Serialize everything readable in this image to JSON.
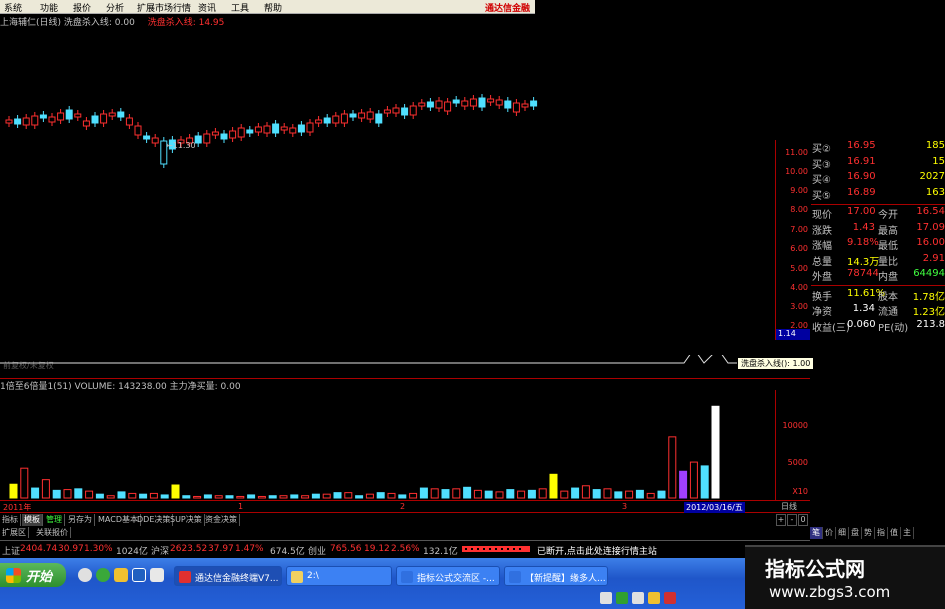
{
  "menu": {
    "items": [
      "系统",
      "功能",
      "报价",
      "分析",
      "扩展市场行情",
      "资讯",
      "工具",
      "帮助"
    ],
    "brand": "通达信金融"
  },
  "chart_title": {
    "main": "上海辅仁(日线)  洗盘杀入线: 0.00",
    "red": "洗盘杀入线: 14.95"
  },
  "kline": {
    "low_label": "←11.30",
    "watermark": "前复权/未复权"
  },
  "yaxis": [
    "11.00",
    "10.00",
    "9.00",
    "8.00",
    "7.00",
    "6.00",
    "5.00",
    "4.00",
    "3.00",
    "2.00"
  ],
  "cursor_value": "1.14",
  "quote": {
    "rows": [
      {
        "l1": "买②",
        "v1": "16.95",
        "l2": "",
        "v2": "185",
        "c1": "#ff3030",
        "c2": "#ffff00"
      },
      {
        "l1": "买③",
        "v1": "16.91",
        "l2": "",
        "v2": "15",
        "c1": "#ff3030",
        "c2": "#ffff00"
      },
      {
        "l1": "买④",
        "v1": "16.90",
        "l2": "",
        "v2": "2027",
        "c1": "#ff3030",
        "c2": "#ffff00"
      },
      {
        "l1": "买⑤",
        "v1": "16.89",
        "l2": "",
        "v2": "163",
        "c1": "#ff3030",
        "c2": "#ffff00"
      },
      {
        "l1": "现价",
        "v1": "17.00",
        "l2": "今开",
        "v2": "16.54",
        "c1": "#ff3030",
        "c2": "#ff3030"
      },
      {
        "l1": "涨跌",
        "v1": "1.43",
        "l2": "最高",
        "v2": "17.09",
        "c1": "#ff3030",
        "c2": "#ff3030"
      },
      {
        "l1": "涨幅",
        "v1": "9.18%",
        "l2": "最低",
        "v2": "16.00",
        "c1": "#ff3030",
        "c2": "#ff3030"
      },
      {
        "l1": "总量",
        "v1": "14.3万",
        "l2": "量比",
        "v2": "2.91",
        "c1": "#ffff00",
        "c2": "#ff3030"
      },
      {
        "l1": "外盘",
        "v1": "78744",
        "l2": "内盘",
        "v2": "64494",
        "c1": "#ff3030",
        "c2": "#40ff40"
      },
      {
        "l1": "换手",
        "v1": "11.61%",
        "l2": "股本",
        "v2": "1.78亿",
        "c1": "#ffff00",
        "c2": "#ffff00"
      },
      {
        "l1": "净资",
        "v1": "1.34",
        "l2": "流通",
        "v2": "1.23亿",
        "c1": "#ffffff",
        "c2": "#ffff00"
      },
      {
        "l1": "收益(三)",
        "v1": "0.060",
        "l2": "PE(动)",
        "v2": "213.8",
        "c1": "#ffffff",
        "c2": "#ffffff"
      }
    ]
  },
  "signal_tooltip": "洗盘杀入线(): 1.00",
  "volume": {
    "header": "1倍至6倍量1(51) VOLUME: 143238.00  主力净买量: 0.00",
    "axis": [
      "10000",
      "5000",
      "X10"
    ]
  },
  "timeaxis": {
    "labels": [
      "2011年",
      "1",
      "2",
      "3"
    ],
    "highlight": "2012/03/16/五",
    "day_label": "日线"
  },
  "tabs": [
    "指标",
    "模板",
    "管理",
    "另存为",
    "MACD基本",
    "DDE决策",
    "SUP决策",
    "资金决策"
  ],
  "tabs2": [
    "扩展区",
    "关联报价"
  ],
  "right_tabs": [
    "笔",
    "价",
    "细",
    "盘",
    "势",
    "指",
    "值",
    "主"
  ],
  "right_btns": [
    "+",
    "-",
    "0"
  ],
  "statusbar": {
    "sh_name": "上证",
    "sh_val": "2404.74",
    "sh_chg": "30.97",
    "sh_pct": "1.30%",
    "sh_amt": "1024亿",
    "sz_name": "沪深",
    "sz_val": "2623.52",
    "sz_chg": "37.97",
    "sz_pct": "1.47%",
    "sz_amt": "674.5亿",
    "cy_name": "创业",
    "cy_val": "765.56",
    "cy_chg": "19.12",
    "cy_pct": "2.56%",
    "cy_amt": "132.1亿",
    "notice": "已断开,点击此处连接行情主站"
  },
  "taskbar": {
    "start": "开始",
    "buttons": [
      "通达信金融终端V7...",
      "2:\\",
      "指标公式交流区 -...",
      "【新提醒】缘多人..."
    ]
  },
  "site_logo": {
    "title": "指标公式网",
    "url": "www.zbgs3.com"
  },
  "chart_data": {
    "type": "bar",
    "title": "",
    "series": [
      {
        "name": "VOLUME",
        "values": [
          1800,
          3900,
          1300,
          2400,
          1000,
          1100,
          1200,
          900,
          500,
          300,
          800,
          600,
          500,
          600,
          400,
          1700,
          300,
          200,
          400,
          300,
          300,
          200,
          400,
          200,
          300,
          300,
          400,
          300,
          500,
          500,
          700,
          700,
          300,
          500,
          700,
          600,
          400,
          600,
          1300,
          1200,
          1100,
          1200,
          1400,
          1000,
          900,
          800,
          1100,
          900,
          1000,
          1200,
          3100,
          900,
          1300,
          1600,
          1100,
          1200,
          800,
          900,
          1000,
          600,
          900,
          8000,
          3500,
          4700,
          4200,
          12000
        ]
      }
    ],
    "ylim": [
      0,
      13000
    ]
  }
}
